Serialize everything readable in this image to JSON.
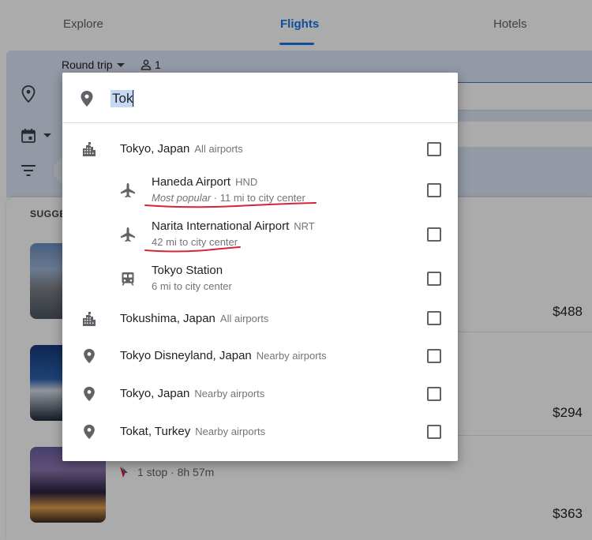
{
  "tabs": [
    {
      "label": "Explore"
    },
    {
      "label": "Flights"
    },
    {
      "label": "Hotels"
    }
  ],
  "search_bar": {
    "trip_type": "Round trip",
    "passenger_count": "1"
  },
  "suggestions": {
    "title": "SUGGE",
    "prices": [
      "$488",
      "$294",
      "$363"
    ],
    "flight_info": "1 stop · 8h 57m"
  },
  "dropdown": {
    "query": "Tok",
    "results": [
      {
        "icon": "city-icon",
        "title": "Tokyo, Japan",
        "sub": "All airports"
      },
      {
        "icon": "airplane-icon",
        "title": "Haneda Airport",
        "sub": "HND",
        "detail_italic": "Most popular",
        "detail": " · 11 mi to city center"
      },
      {
        "icon": "airplane-icon",
        "title": "Narita International Airport",
        "sub": "NRT",
        "detail": "42 mi to city center"
      },
      {
        "icon": "train-icon",
        "title": "Tokyo Station",
        "sub": "",
        "detail": "6 mi to city center"
      },
      {
        "icon": "city-icon",
        "title": "Tokushima, Japan",
        "sub": "All airports"
      },
      {
        "icon": "location-pin-icon",
        "title": "Tokyo Disneyland, Japan",
        "sub": "Nearby airports"
      },
      {
        "icon": "location-pin-icon",
        "title": "Tokyo, Japan",
        "sub": "Nearby airports"
      },
      {
        "icon": "location-pin-icon",
        "title": "Tokat, Turkey",
        "sub": "Nearby airports"
      }
    ]
  },
  "colors": {
    "accent": "#1a73e8",
    "annotation": "#d6243c"
  }
}
